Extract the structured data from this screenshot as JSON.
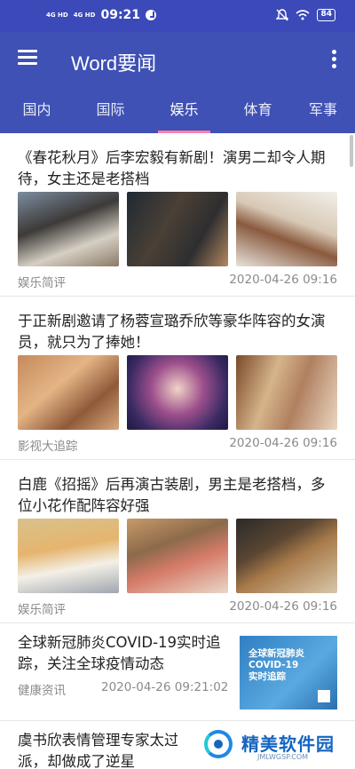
{
  "status_bar": {
    "signal_1": "4G HD",
    "signal_2": "4G HD",
    "time": "09:21",
    "battery": "84",
    "icons": [
      "clock-icon",
      "mute-icon",
      "wifi-icon",
      "battery-icon"
    ]
  },
  "app_bar": {
    "title": "Word要闻",
    "icons": [
      "menu-icon",
      "more-vert-icon"
    ]
  },
  "tabs": [
    {
      "label": "国内",
      "active": false
    },
    {
      "label": "国际",
      "active": false
    },
    {
      "label": "娱乐",
      "active": true
    },
    {
      "label": "体育",
      "active": false
    },
    {
      "label": "军事",
      "active": false
    }
  ],
  "articles": [
    {
      "title": "《春花秋月》后李宏毅有新剧！演男二却令人期待，女主还是老搭档",
      "source": "娱乐简评",
      "time": "2020-04-26 09:16"
    },
    {
      "title": "于正新剧邀请了杨蓉宣璐乔欣等豪华阵容的女演员，就只为了捧她！",
      "source": "影视大追踪",
      "time": "2020-04-26 09:16"
    },
    {
      "title": "白鹿《招摇》后再演古装剧，男主是老搭档，多位小花作配阵容好强",
      "source": "娱乐简评",
      "time": "2020-04-26 09:16"
    },
    {
      "title": "全球新冠肺炎COVID-19实时追踪，关注全球疫情动态",
      "source": "健康资讯",
      "time": "2020-04-26 09:21:02",
      "thumb_text": [
        "全球新冠肺炎",
        "COVID-19",
        "实时追踪"
      ]
    },
    {
      "title": "虞书欣表情管理专家太过火，一个出场就被骂像派，却做成了逆星"
    }
  ],
  "watermark": {
    "text": "精美软件园",
    "url": "JMLWGSP.COM"
  },
  "colors": {
    "primary": "#3f51b5",
    "status_bar": "#3b4ab8",
    "tab_indicator": "#ff80ab"
  }
}
